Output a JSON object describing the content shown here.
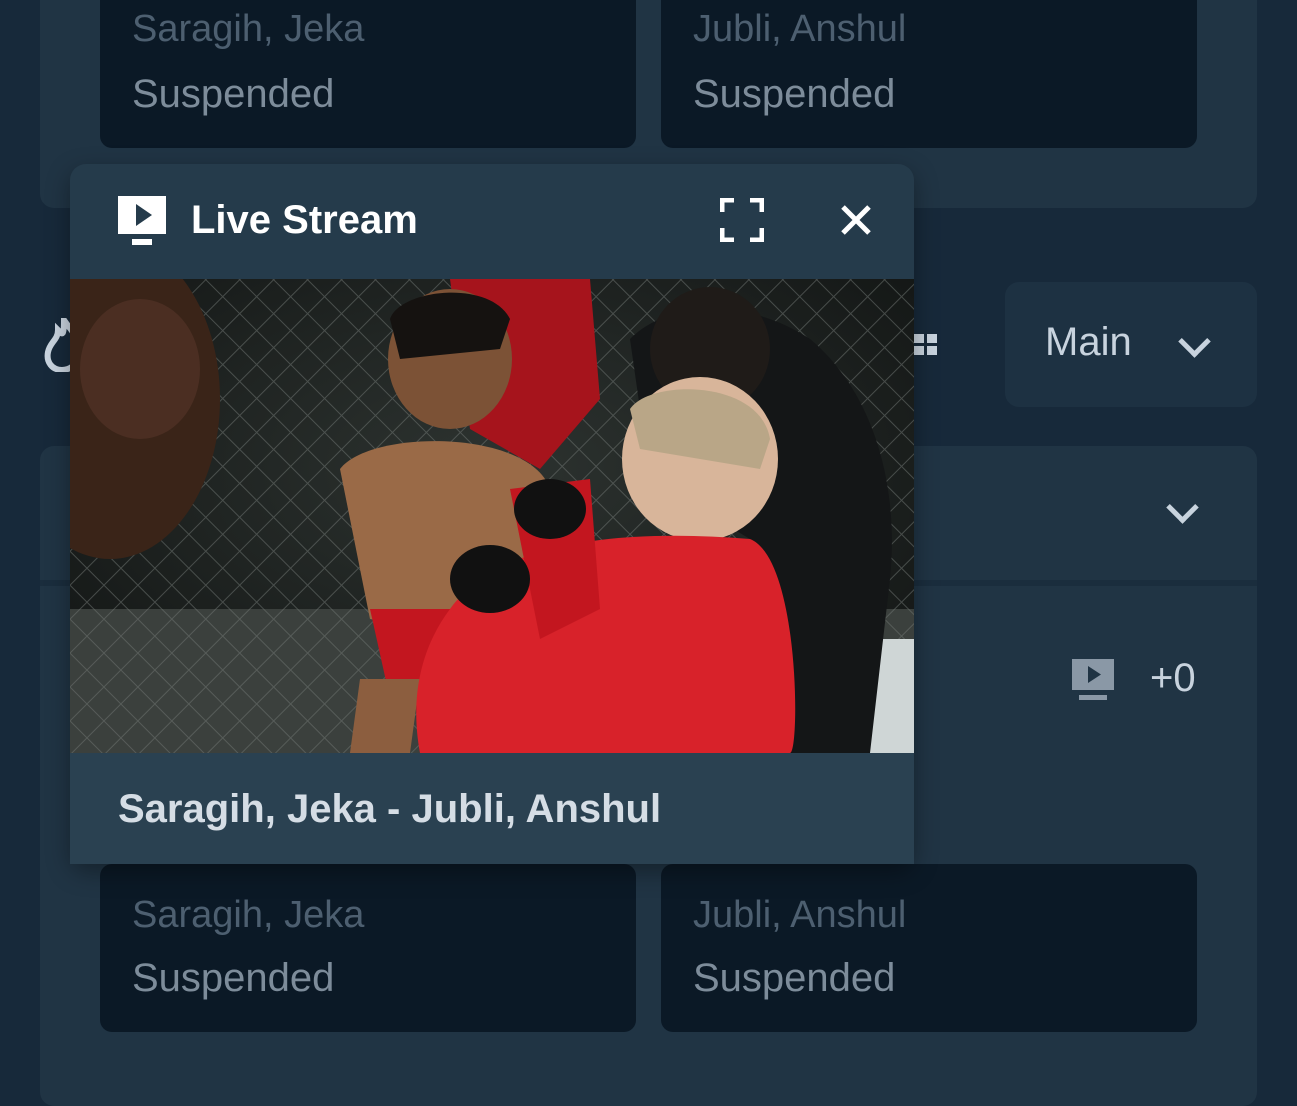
{
  "top_market": {
    "left": {
      "name": "Saragih, Jeka",
      "status": "Suspended"
    },
    "right": {
      "name": "Jubli, Anshul",
      "status": "Suspended"
    }
  },
  "bottom_market": {
    "left": {
      "name": "Saragih, Jeka",
      "status": "Suspended"
    },
    "right": {
      "name": "Jubli, Anshul",
      "status": "Suspended"
    }
  },
  "market_selector": {
    "label": "Main"
  },
  "event_row": {
    "stream_count": "+0"
  },
  "live_stream": {
    "title": "Live Stream",
    "matchup": "Saragih, Jeka - Jubli, Anshul"
  },
  "icons": {
    "stream": "tv-play-icon",
    "fullscreen": "fullscreen-icon",
    "close": "close-icon",
    "chevron": "chevron-down-icon",
    "grid": "grid-icon",
    "fire": "fire-icon"
  },
  "colors": {
    "background": "#17293a",
    "card": "#203444",
    "odds_button": "#0b1926",
    "popup": "#253b4b",
    "accent_red": "#d8222a"
  }
}
